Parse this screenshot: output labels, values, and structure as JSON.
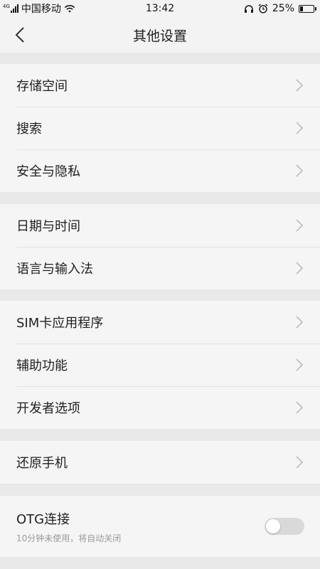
{
  "status_bar": {
    "network_label": "4G",
    "carrier": "中国移动",
    "time": "13:42",
    "battery_percent": "25%",
    "battery_level": 0.25
  },
  "header": {
    "title": "其他设置",
    "back_icon": "chevron-left-icon"
  },
  "groups": [
    {
      "items": [
        {
          "label": "存储空间"
        },
        {
          "label": "搜索"
        },
        {
          "label": "安全与隐私"
        }
      ]
    },
    {
      "items": [
        {
          "label": "日期与时间"
        },
        {
          "label": "语言与输入法"
        }
      ]
    },
    {
      "items": [
        {
          "label": "SIM卡应用程序"
        },
        {
          "label": "辅助功能"
        },
        {
          "label": "开发者选项"
        }
      ]
    },
    {
      "items": [
        {
          "label": "还原手机"
        }
      ]
    }
  ],
  "otg": {
    "label": "OTG连接",
    "subtitle": "10分钟未使用，将自动关闭",
    "enabled": false
  },
  "colors": {
    "background": "#e9e9e9",
    "card": "#f5f5f5",
    "chevron": "#b5b5b5",
    "toggle_off": "#d9d9d9"
  }
}
